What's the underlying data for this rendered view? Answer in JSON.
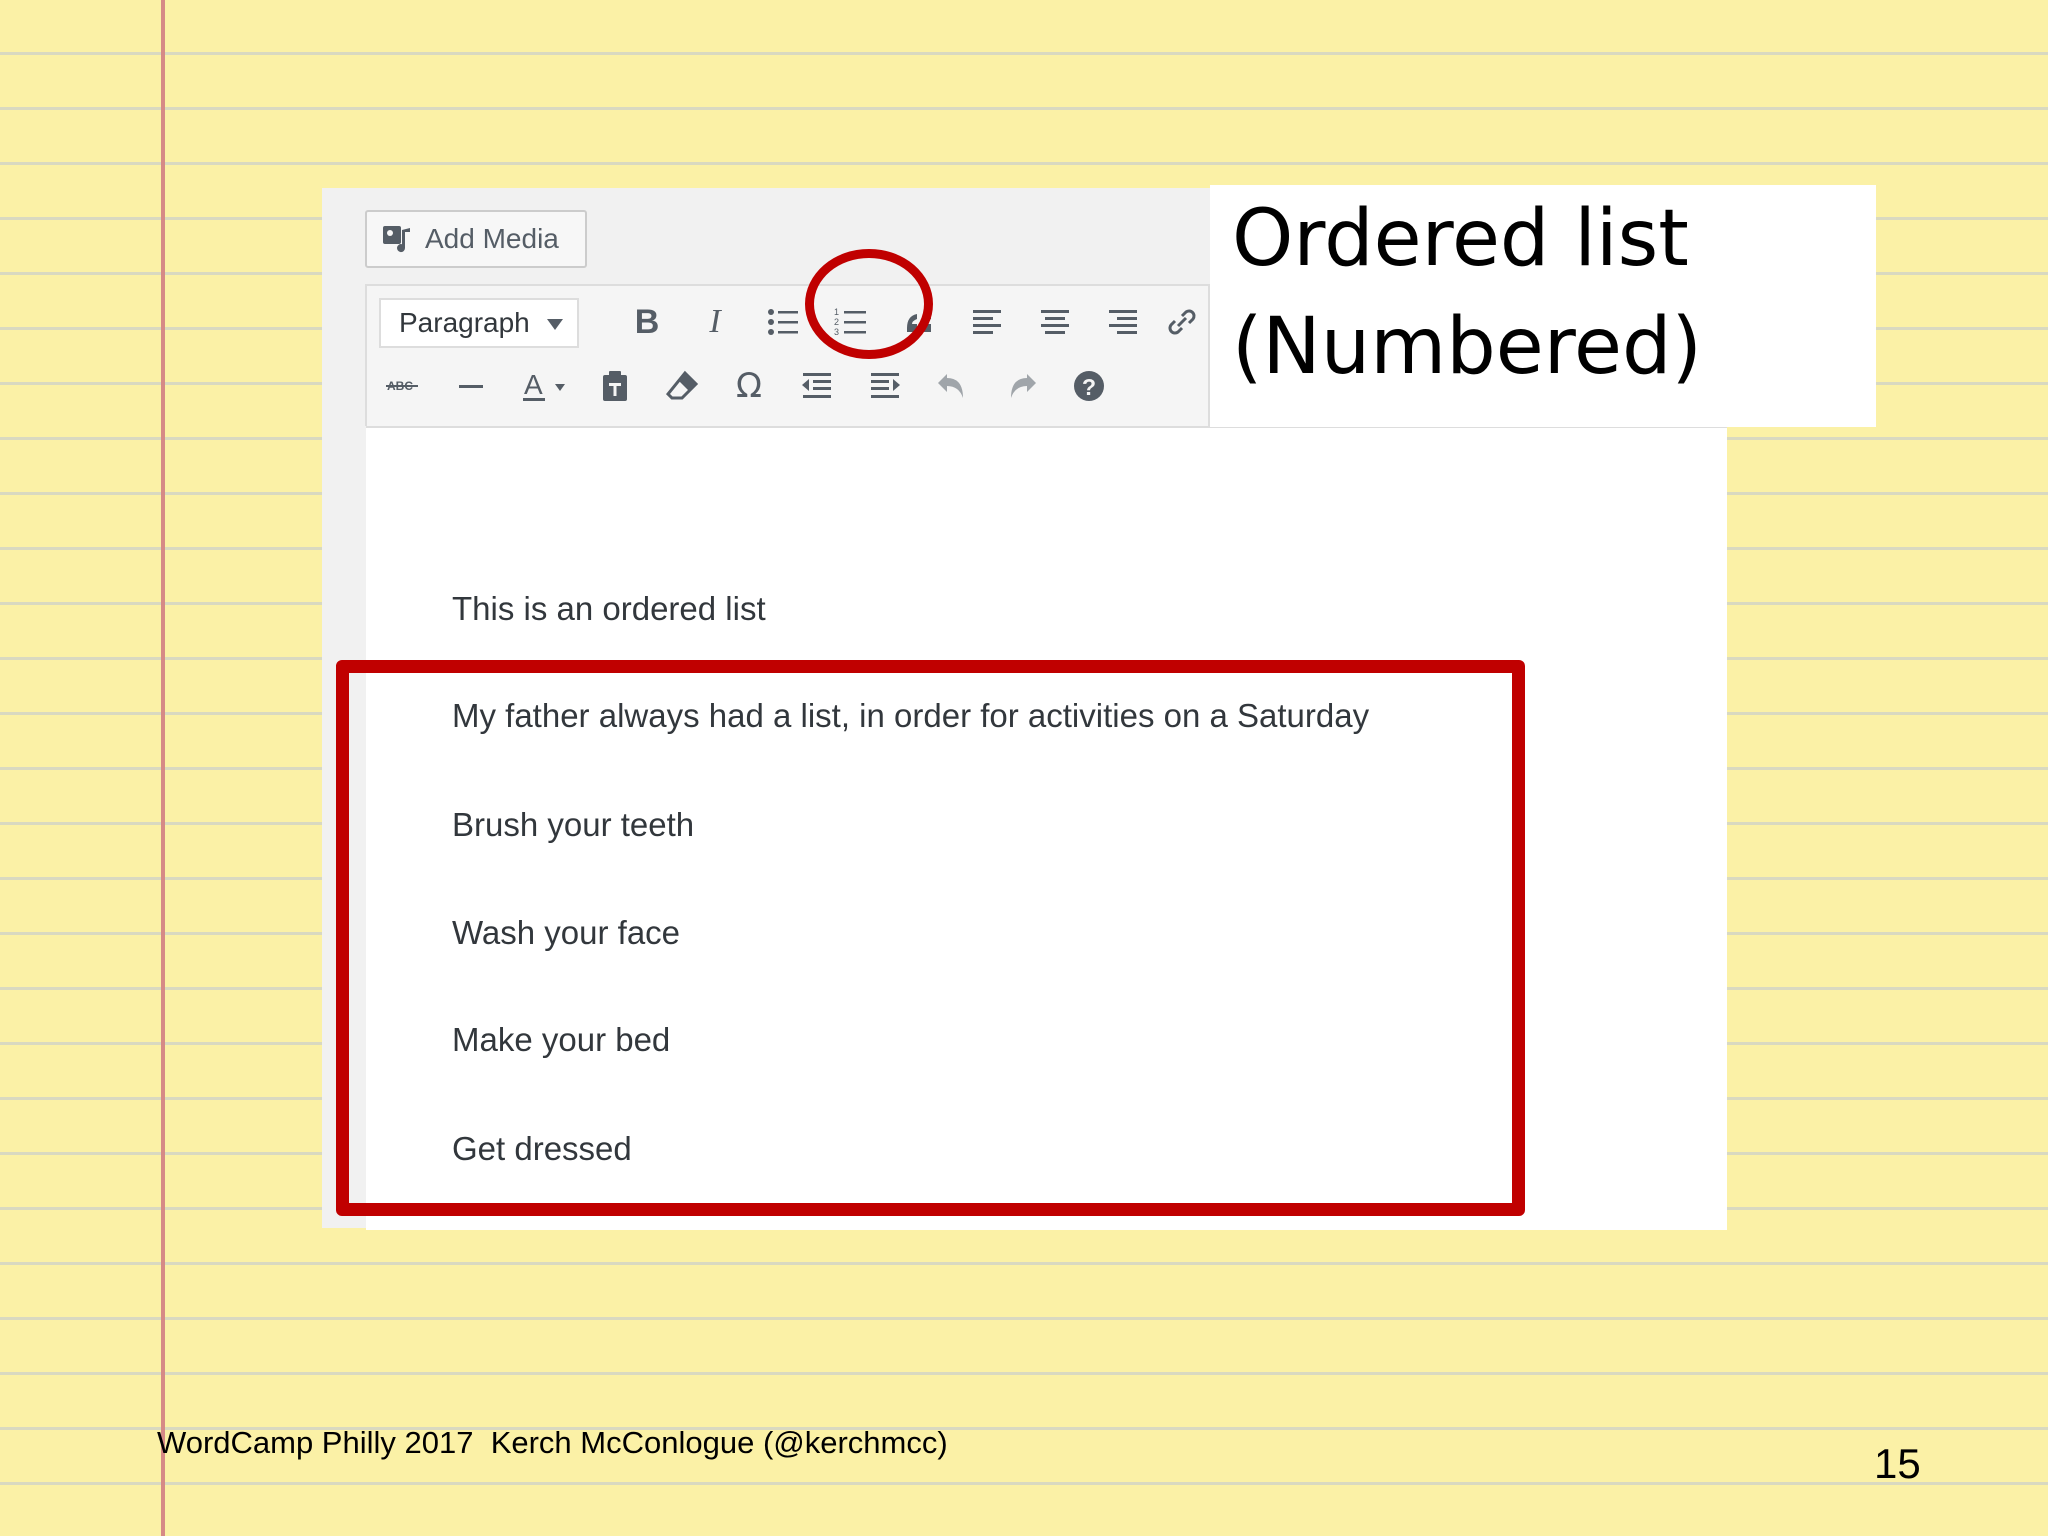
{
  "editor": {
    "add_media_label": "Add Media",
    "format_select": "Paragraph",
    "toolbar_row1": [
      "bold",
      "italic",
      "bulleted-list",
      "numbered-list",
      "blockquote",
      "align-left",
      "align-center",
      "align-right",
      "insert-link"
    ],
    "toolbar_row2": [
      "strikethrough",
      "horizontal-line",
      "text-color",
      "paste-as-text",
      "clear-formatting",
      "special-character",
      "decrease-indent",
      "increase-indent",
      "undo",
      "redo",
      "keyboard-shortcuts"
    ],
    "intro_line": "This is an ordered list",
    "lines": [
      "My father always had a list, in order for activities on a Saturday",
      "Brush your teeth",
      "Wash your face",
      "Make your bed",
      "Get dressed"
    ]
  },
  "callout": {
    "line1": "Ordered list",
    "line2": "(Numbered)"
  },
  "highlight_color": "#c00000",
  "footer": {
    "text": "WordCamp Philly 2017  Kerch McConlogue (@kerchmcc)",
    "page_number": "15"
  }
}
